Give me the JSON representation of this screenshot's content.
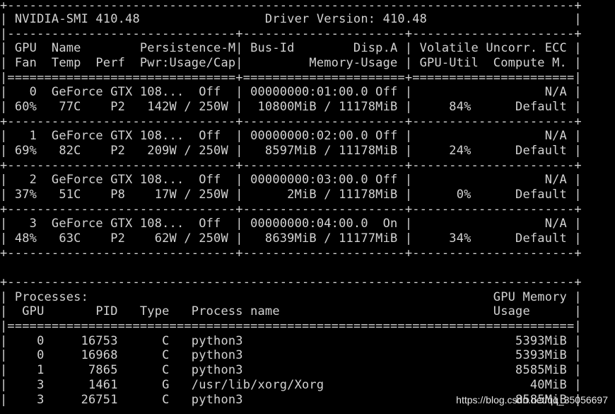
{
  "terminal": {
    "background": "#000000",
    "foreground": "#d2d2d2",
    "lines": [
      "+-----------------------------------------------------------------------------+",
      "| NVIDIA-SMI 410.48                 Driver Version: 410.48                    |",
      "|-------------------------------+----------------------+----------------------+",
      "| GPU  Name        Persistence-M| Bus-Id        Disp.A | Volatile Uncorr. ECC |",
      "| Fan  Temp  Perf  Pwr:Usage/Cap|         Memory-Usage | GPU-Util  Compute M. |",
      "|===============================+======================+======================|",
      "|   0  GeForce GTX 108...  Off  | 00000000:01:00.0 Off |                  N/A |",
      "| 60%   77C    P2   142W / 250W |  10800MiB / 11178MiB |     84%      Default |",
      "+-------------------------------+----------------------+----------------------+",
      "|   1  GeForce GTX 108...  Off  | 00000000:02:00.0 Off |                  N/A |",
      "| 69%   82C    P2   209W / 250W |   8597MiB / 11178MiB |     24%      Default |",
      "+-------------------------------+----------------------+----------------------+",
      "|   2  GeForce GTX 108...  Off  | 00000000:03:00.0 Off |                  N/A |",
      "| 37%   51C    P8    17W / 250W |      2MiB / 11178MiB |      0%      Default |",
      "+-------------------------------+----------------------+----------------------+",
      "|   3  GeForce GTX 108...  Off  | 00000000:04:00.0  On |                  N/A |",
      "| 48%   63C    P2    62W / 250W |   8639MiB / 11177MiB |     34%      Default |",
      "+-------------------------------+----------------------+----------------------+",
      "",
      "+-----------------------------------------------------------------------------+",
      "| Processes:                                                       GPU Memory |",
      "|  GPU       PID   Type   Process name                             Usage      |",
      "|=============================================================================|",
      "|    0     16753      C   python3                                     5393MiB |",
      "|    0     16968      C   python3                                     5393MiB |",
      "|    1      7865      C   python3                                     8585MiB |",
      "|    3      1461      G   /usr/lib/xorg/Xorg                            40MiB |",
      "|    3     26751      C   python3                                     8585MiB |"
    ]
  },
  "watermark": {
    "text": "https://blog.csdn.net/qq_35056697",
    "color": "#e8e8e8"
  }
}
